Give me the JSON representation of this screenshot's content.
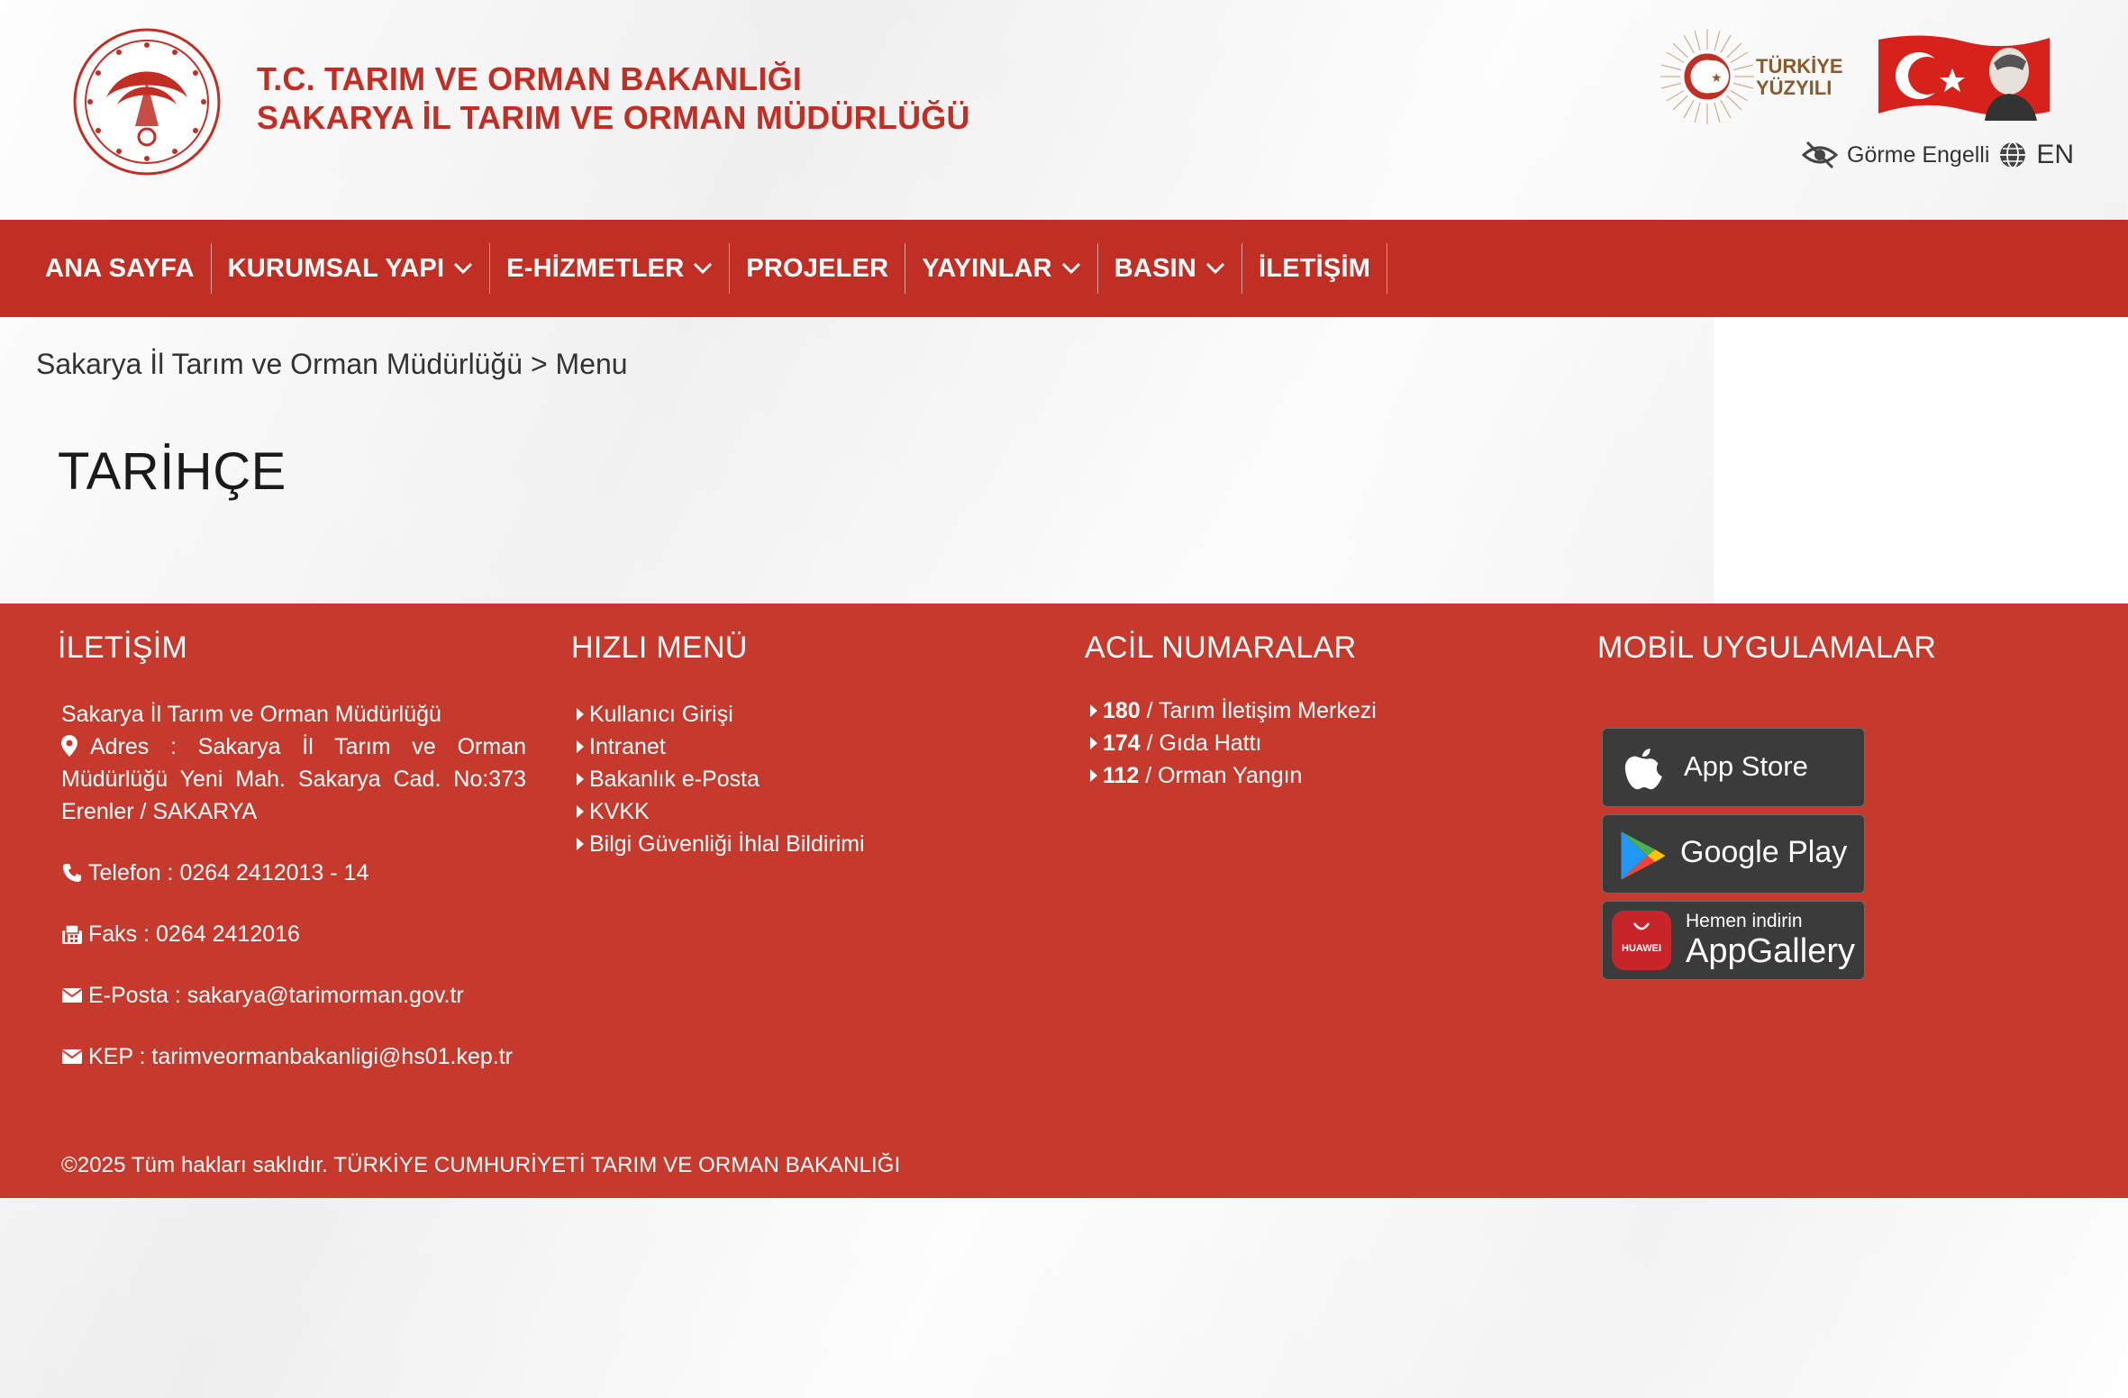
{
  "header": {
    "title_line1": "T.C. TARIM VE ORMAN BAKANLIĞI",
    "title_line2": "SAKARYA İL TARIM VE ORMAN MÜDÜRLÜĞÜ",
    "century_logo_text1": "TÜRKİYE",
    "century_logo_text2": "YÜZYILI",
    "accessibility_label": "Görme Engelli",
    "language_label": "EN"
  },
  "nav": {
    "items": [
      {
        "label": "ANA SAYFA",
        "dropdown": false
      },
      {
        "label": "KURUMSAL YAPI",
        "dropdown": true
      },
      {
        "label": "E-HİZMETLER",
        "dropdown": true
      },
      {
        "label": "PROJELER",
        "dropdown": false
      },
      {
        "label": "YAYINLAR",
        "dropdown": true
      },
      {
        "label": "BASIN",
        "dropdown": true
      },
      {
        "label": "İLETİŞİM",
        "dropdown": false
      }
    ]
  },
  "breadcrumb": {
    "parent": "Sakarya İl Tarım ve Orman Müdürlüğü",
    "separator": ">",
    "current": "Menu"
  },
  "page": {
    "title": "TARİHÇE"
  },
  "footer": {
    "contact": {
      "heading": "İLETİŞİM",
      "org": "Sakarya İl Tarım ve Orman Müdürlüğü",
      "address": "Adres : Sakarya İl Tarım ve Orman Müdürlüğü Yeni Mah. Sakarya Cad. No:373 Erenler / SAKARYA",
      "phone": "Telefon : 0264 2412013 - 14",
      "fax": "Faks : 0264 2412016",
      "email": "E-Posta : sakarya@tarimorman.gov.tr",
      "kep": "KEP : tarimveormanbakanligi@hs01.kep.tr"
    },
    "quick_menu": {
      "heading": "HIZLI MENÜ",
      "links": [
        "Kullanıcı Girişi",
        "Intranet",
        "Bakanlık e-Posta",
        "KVKK",
        "Bilgi Güvenliği İhlal Bildirimi"
      ]
    },
    "emergency": {
      "heading": "ACİL NUMARALAR",
      "items": [
        {
          "number": "180",
          "label": " / Tarım İletişim Merkezi"
        },
        {
          "number": "174",
          "label": " / Gıda Hattı"
        },
        {
          "number": "112",
          "label": " / Orman Yangın"
        }
      ]
    },
    "mobile": {
      "heading": "MOBİL UYGULAMALAR",
      "app_store": "App Store",
      "google_play": "Google Play",
      "app_gallery_small": "Hemen indirin",
      "app_gallery": "AppGallery",
      "huawei_brand": "HUAWEI"
    },
    "copyright": "©2025 Tüm hakları saklıdır. TÜRKİYE CUMHURİYETİ TARIM VE ORMAN BAKANLIĞI"
  },
  "colors": {
    "brand_red": "#c12e24",
    "footer_red": "#c53a2d"
  }
}
